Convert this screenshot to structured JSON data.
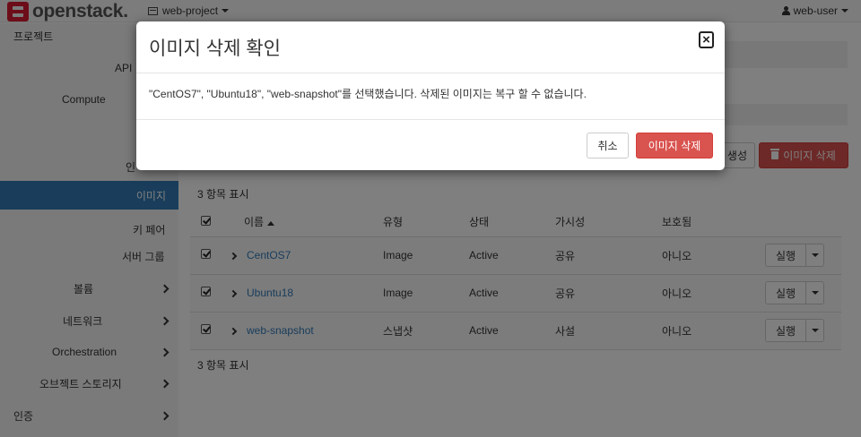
{
  "topbar": {
    "brand": "openstack",
    "brand_mark": ".",
    "project": "web-project",
    "user": "web-user"
  },
  "sidebar": {
    "project_header": "프로젝트",
    "items": [
      {
        "label": "API",
        "active": false
      },
      {
        "label": "Compute",
        "active": false
      },
      {
        "label": "인",
        "active": false
      },
      {
        "label": "이미지",
        "active": true
      },
      {
        "label": "키 페어",
        "active": false
      },
      {
        "label": "서버 그룹",
        "active": false
      },
      {
        "label": "볼륨",
        "expandable": true
      },
      {
        "label": "네트워크",
        "expandable": true
      },
      {
        "label": "Orchestration",
        "expandable": true
      },
      {
        "label": "오브젝트 스토리지",
        "expandable": true
      },
      {
        "label": "인증",
        "expandable": true
      }
    ]
  },
  "toolbar": {
    "create_label": "생성",
    "delete_label": "이미지 삭제"
  },
  "table": {
    "count_top": "3 항목 표시",
    "count_bottom": "3 항목 표시",
    "headers": {
      "name": "이름",
      "type": "유형",
      "status": "상태",
      "visibility": "가시성",
      "protected": "보호됨"
    },
    "rows": [
      {
        "name": "CentOS7",
        "type": "Image",
        "status": "Active",
        "visibility": "공유",
        "protected": "아니오",
        "action": "실행"
      },
      {
        "name": "Ubuntu18",
        "type": "Image",
        "status": "Active",
        "visibility": "공유",
        "protected": "아니오",
        "action": "실행"
      },
      {
        "name": "web-snapshot",
        "type": "스냅샷",
        "status": "Active",
        "visibility": "사설",
        "protected": "아니오",
        "action": "실행"
      }
    ]
  },
  "modal": {
    "title": "이미지 삭제 확인",
    "close_glyph": "×",
    "message": "\"CentOS7\", \"Ubuntu18\", \"web-snapshot\"를 선택했습니다. 삭제된 이미지는 복구 할 수 없습니다.",
    "cancel_label": "취소",
    "confirm_label": "이미지 삭제"
  },
  "colors": {
    "primary": "#337ab7",
    "danger": "#d9534f",
    "brand_red": "#da1a32"
  }
}
